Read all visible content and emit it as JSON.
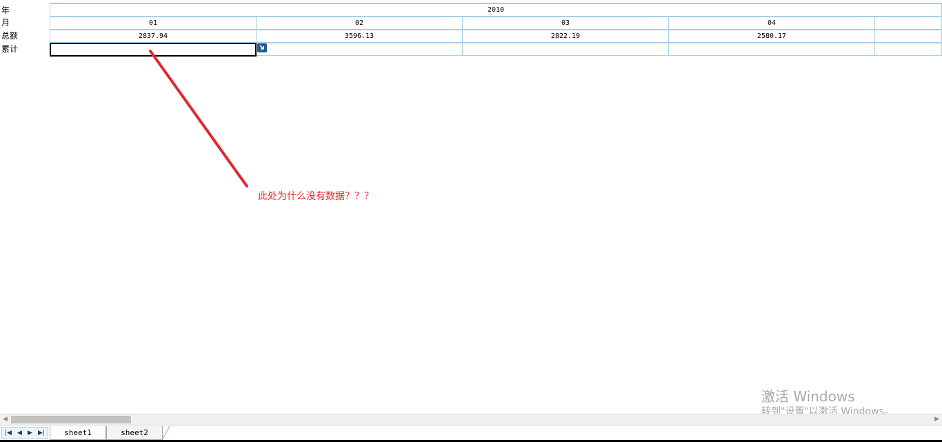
{
  "sheet": {
    "row_labels": [
      "年",
      "月",
      "总额",
      "累计"
    ],
    "year": "2010",
    "months": [
      "01",
      "02",
      "03",
      "04",
      ""
    ],
    "totals": [
      "2837.94",
      "3596.13",
      "2822.19",
      "2580.17",
      ""
    ],
    "cumulative": [
      "",
      "",
      "",
      "",
      ""
    ]
  },
  "annotation": {
    "text": "此处为什么没有数据？？？",
    "color": "#e0282e"
  },
  "watermark": {
    "title": "激活 Windows",
    "subtitle": "转到\"设置\"以激活 Windows。"
  },
  "tabs": [
    "sheet1",
    "sheet2"
  ],
  "nav_icons": [
    "first-sheet-icon",
    "prev-sheet-icon",
    "next-sheet-icon",
    "last-sheet-icon"
  ],
  "colors": {
    "grid_border": "#a9cfe9",
    "fill_handle": "#1f5b93"
  }
}
